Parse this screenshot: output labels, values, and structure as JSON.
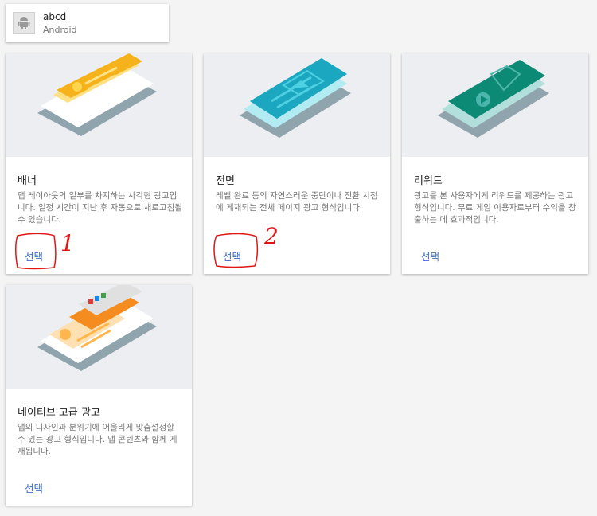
{
  "app": {
    "name": "abcd",
    "platform": "Android",
    "icon": "android-icon"
  },
  "cards": [
    {
      "id": "banner",
      "title": "배너",
      "description": "앱 레이아웃의 일부를 차지하는 사각형 광고입니다. 일정 시간이 지난 후 자동으로 새로고침될 수 있습니다.",
      "select_label": "선택",
      "accent": "#f6b21a"
    },
    {
      "id": "interstitial",
      "title": "전면",
      "description": "레벨 완료 등의 자연스러운 중단이나 전환 시점에 게재되는 전체 페이지 광고 형식입니다.",
      "select_label": "선택",
      "accent": "#1aa7bf"
    },
    {
      "id": "rewarded",
      "title": "리워드",
      "description": "광고를 본 사용자에게 리워드를 제공하는 광고 형식입니다. 무료 게임 이용자로부터 수익을 창출하는 데 효과적입니다.",
      "select_label": "선택",
      "accent": "#0d8a75"
    },
    {
      "id": "native",
      "title": "네이티브 고급 광고",
      "description": "앱의 디자인과 분위기에 어울리게 맞춤설정할 수 있는 광고 형식입니다. 앱 콘텐츠와 함께 게재됩니다.",
      "select_label": "선택",
      "accent": "#f58c1f"
    }
  ],
  "annotations": {
    "label_1": "1",
    "label_2": "2",
    "color": "#e01515"
  }
}
